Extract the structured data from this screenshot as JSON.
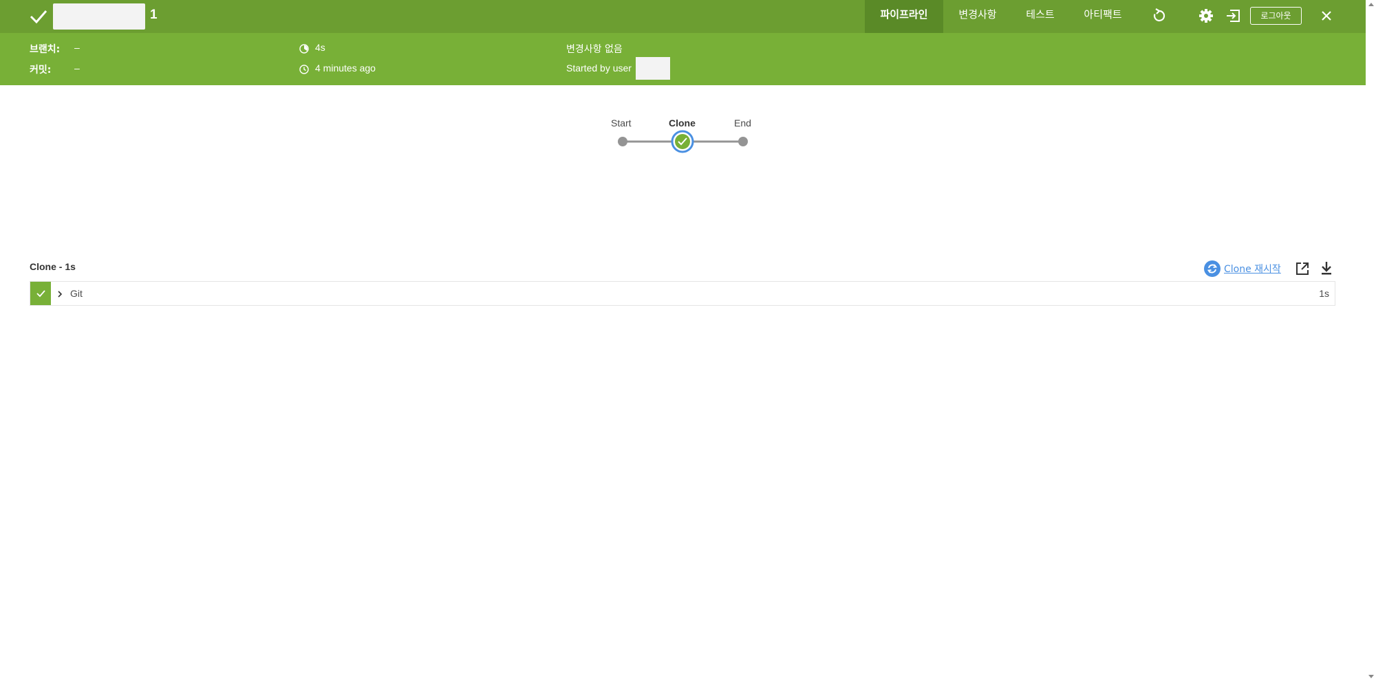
{
  "header": {
    "run_number": "1",
    "tabs": [
      {
        "label": "파이프라인",
        "active": true
      },
      {
        "label": "변경사항",
        "active": false
      },
      {
        "label": "테스트",
        "active": false
      },
      {
        "label": "아티팩트",
        "active": false
      }
    ],
    "logout_label": "로그아웃",
    "icons": [
      "check-icon",
      "replay-icon",
      "gear-icon",
      "sign-in-icon",
      "close-icon"
    ]
  },
  "summary": {
    "branch_label": "브랜치:",
    "branch_value": "–",
    "commit_label": "커밋:",
    "commit_value": "–",
    "duration": "4s",
    "started_ago": "4 minutes ago",
    "changes": "변경사항 없음",
    "started_by": "Started by user"
  },
  "pipeline": {
    "stages": [
      {
        "label": "Start",
        "selected": false
      },
      {
        "label": "Clone",
        "selected": true,
        "status": "success"
      },
      {
        "label": "End",
        "selected": false
      }
    ]
  },
  "steps": {
    "title": "Clone - 1s",
    "restart_label": "Clone 재시작",
    "items": [
      {
        "name": "Git",
        "duration": "1s",
        "status": "success"
      }
    ]
  },
  "colors": {
    "topbar": "#6c9e31",
    "subbar": "#78b037",
    "active_tab": "#5a8a27",
    "link": "#4a90e2",
    "node": "#949494"
  }
}
